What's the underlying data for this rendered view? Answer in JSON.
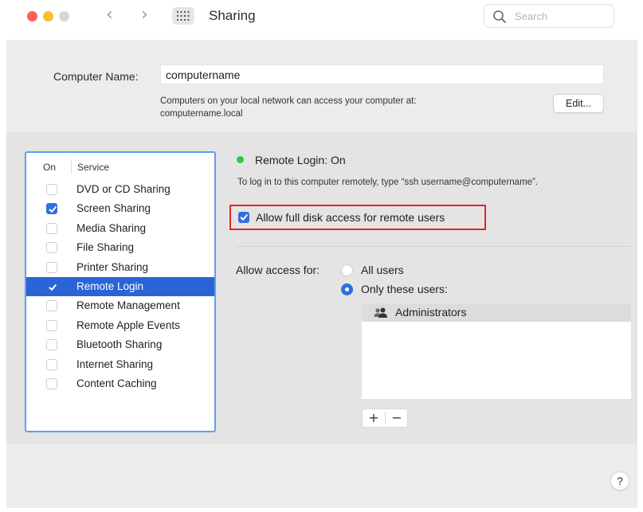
{
  "window": {
    "title": "Sharing",
    "search_placeholder": "Search",
    "colors": {
      "close": "#fe5f57",
      "minimize": "#febc2e",
      "zoom": "#d6d6d6"
    }
  },
  "computer_name": {
    "label": "Computer Name:",
    "value": "computername",
    "description_line1": "Computers on your local network can access your computer at:",
    "description_line2": "computername.local",
    "edit_button": "Edit..."
  },
  "services": {
    "header_on": "On",
    "header_service": "Service",
    "items": [
      {
        "label": "DVD or CD Sharing",
        "checked": false,
        "selected": false
      },
      {
        "label": "Screen Sharing",
        "checked": true,
        "selected": false
      },
      {
        "label": "Media Sharing",
        "checked": false,
        "selected": false
      },
      {
        "label": "File Sharing",
        "checked": false,
        "selected": false
      },
      {
        "label": "Printer Sharing",
        "checked": false,
        "selected": false
      },
      {
        "label": "Remote Login",
        "checked": true,
        "selected": true
      },
      {
        "label": "Remote Management",
        "checked": false,
        "selected": false
      },
      {
        "label": "Remote Apple Events",
        "checked": false,
        "selected": false
      },
      {
        "label": "Bluetooth Sharing",
        "checked": false,
        "selected": false
      },
      {
        "label": "Internet Sharing",
        "checked": false,
        "selected": false
      },
      {
        "label": "Content Caching",
        "checked": false,
        "selected": false
      }
    ]
  },
  "detail": {
    "status": "Remote Login: On",
    "status_color": "#2fc748",
    "instructions": "To log in to this computer remotely, type “ssh username@computername”.",
    "full_disk_label": "Allow full disk access for remote users",
    "full_disk_checked": true,
    "allow_access_label": "Allow access for:",
    "radio_all": "All users",
    "radio_only": "Only these users:",
    "selected_radio": "only",
    "users": [
      "Administrators"
    ],
    "add_button": "+",
    "remove_button": "−"
  },
  "help_button": "?"
}
